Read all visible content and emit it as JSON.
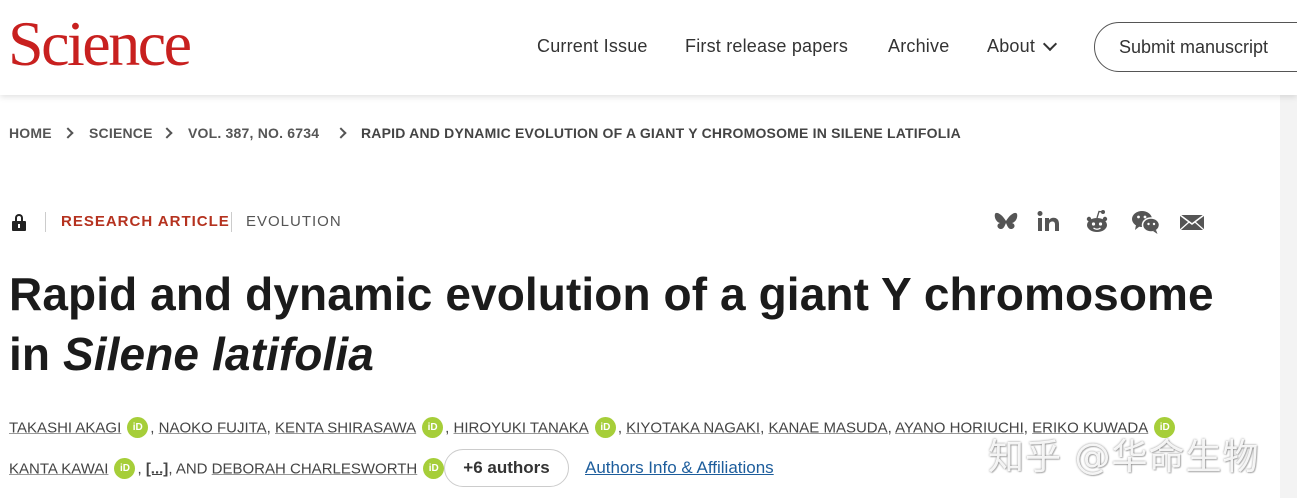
{
  "header": {
    "logo": "Science",
    "nav": [
      "Current Issue",
      "First release papers",
      "Archive",
      "About"
    ],
    "submit_label": "Submit manuscript"
  },
  "breadcrumb": [
    "HOME",
    "SCIENCE",
    "VOL. 387, NO. 6734",
    "RAPID AND DYNAMIC EVOLUTION OF A GIANT Y CHROMOSOME IN SILENE LATIFOLIA"
  ],
  "meta": {
    "article_type": "RESEARCH ARTICLE",
    "subject": "EVOLUTION"
  },
  "share_icons": [
    "bluesky-icon",
    "linkedin-icon",
    "reddit-icon",
    "wechat-icon",
    "email-icon"
  ],
  "title": {
    "main": "Rapid and dynamic evolution of a giant Y chromosome",
    "in": "in",
    "species": "Silene latifolia"
  },
  "authors": {
    "a1": "TAKASHI AKAGI",
    "a2": "NAOKO FUJITA",
    "a3": "KENTA SHIRASAWA",
    "a4": "HIROYUKI TANAKA",
    "a5": "KIYOTAKA NAGAKI",
    "a6": "KANAE MASUDA",
    "a7": "AYANO HORIUCHI",
    "a8": "ERIKO KUWADA",
    "a9": "KANTA KAWAI",
    "ellipsis": "[...]",
    "and": ", AND",
    "last": "DEBORAH CHARLESWORTH",
    "orcid": "iD",
    "more_label": "+6 authors",
    "affiliations_label": "Authors Info & Affiliations"
  },
  "watermark": "知乎 @华命生物",
  "colors": {
    "brand_red": "#c8201f",
    "article_type": "#b5321f",
    "orcid_green": "#a6ce39",
    "link_blue": "#1d5d9c"
  }
}
